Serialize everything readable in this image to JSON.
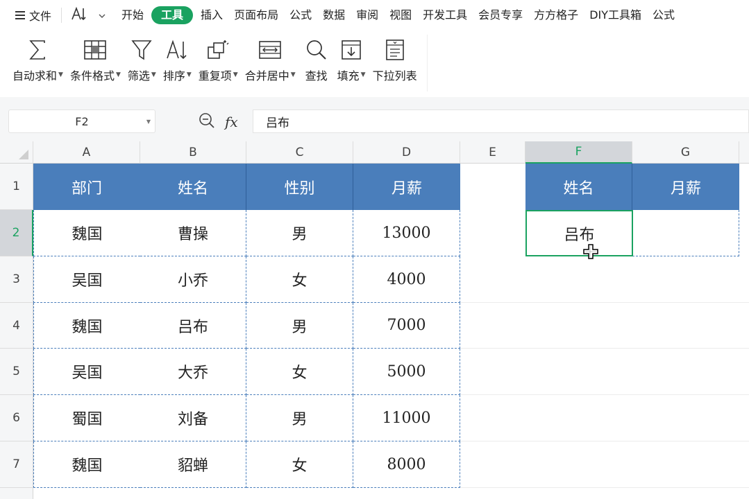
{
  "menu": {
    "file_label": "文件",
    "tabs": [
      "开始",
      "工具",
      "插入",
      "页面布局",
      "公式",
      "数据",
      "审阅",
      "视图",
      "开发工具",
      "会员专享",
      "方方格子",
      "DIY工具箱",
      "公式"
    ],
    "active_tab": 1,
    "accent": "#1aa260"
  },
  "ribbon": {
    "buttons": [
      {
        "label": "自动求和",
        "icon": "sum-icon",
        "dropdown": true
      },
      {
        "label": "条件格式",
        "icon": "table-icon",
        "dropdown": true
      },
      {
        "label": "筛选",
        "icon": "filter-icon",
        "dropdown": true
      },
      {
        "label": "排序",
        "icon": "sort-icon",
        "dropdown": true
      },
      {
        "label": "重复项",
        "icon": "duplicate-icon",
        "dropdown": true
      },
      {
        "label": "合并居中",
        "icon": "merge-icon",
        "dropdown": true
      },
      {
        "label": "查找",
        "icon": "search-icon",
        "dropdown": false
      },
      {
        "label": "填充",
        "icon": "fill-icon",
        "dropdown": true
      },
      {
        "label": "下拉列表",
        "icon": "dropdown-list-icon",
        "dropdown": false
      }
    ]
  },
  "formula_bar": {
    "name_box": "F2",
    "fx_label": "fx",
    "value": "吕布"
  },
  "sheet": {
    "columns": [
      "A",
      "B",
      "C",
      "D",
      "E",
      "F",
      "G"
    ],
    "rows": [
      "1",
      "2",
      "3",
      "4",
      "5",
      "6",
      "7"
    ],
    "selected_column": "F",
    "selected_row": "2",
    "header_color": "#4a7ebb",
    "table_header": [
      "部门",
      "姓名",
      "性别",
      "月薪"
    ],
    "table_rows": [
      [
        "魏国",
        "曹操",
        "男",
        "13000"
      ],
      [
        "吴国",
        "小乔",
        "女",
        "4000"
      ],
      [
        "魏国",
        "吕布",
        "男",
        "7000"
      ],
      [
        "吴国",
        "大乔",
        "女",
        "5000"
      ],
      [
        "蜀国",
        "刘备",
        "男",
        "11000"
      ],
      [
        "魏国",
        "貂蝉",
        "女",
        "8000"
      ]
    ],
    "lookup_header": [
      "姓名",
      "月薪"
    ],
    "lookup_row": [
      "吕布",
      ""
    ]
  }
}
